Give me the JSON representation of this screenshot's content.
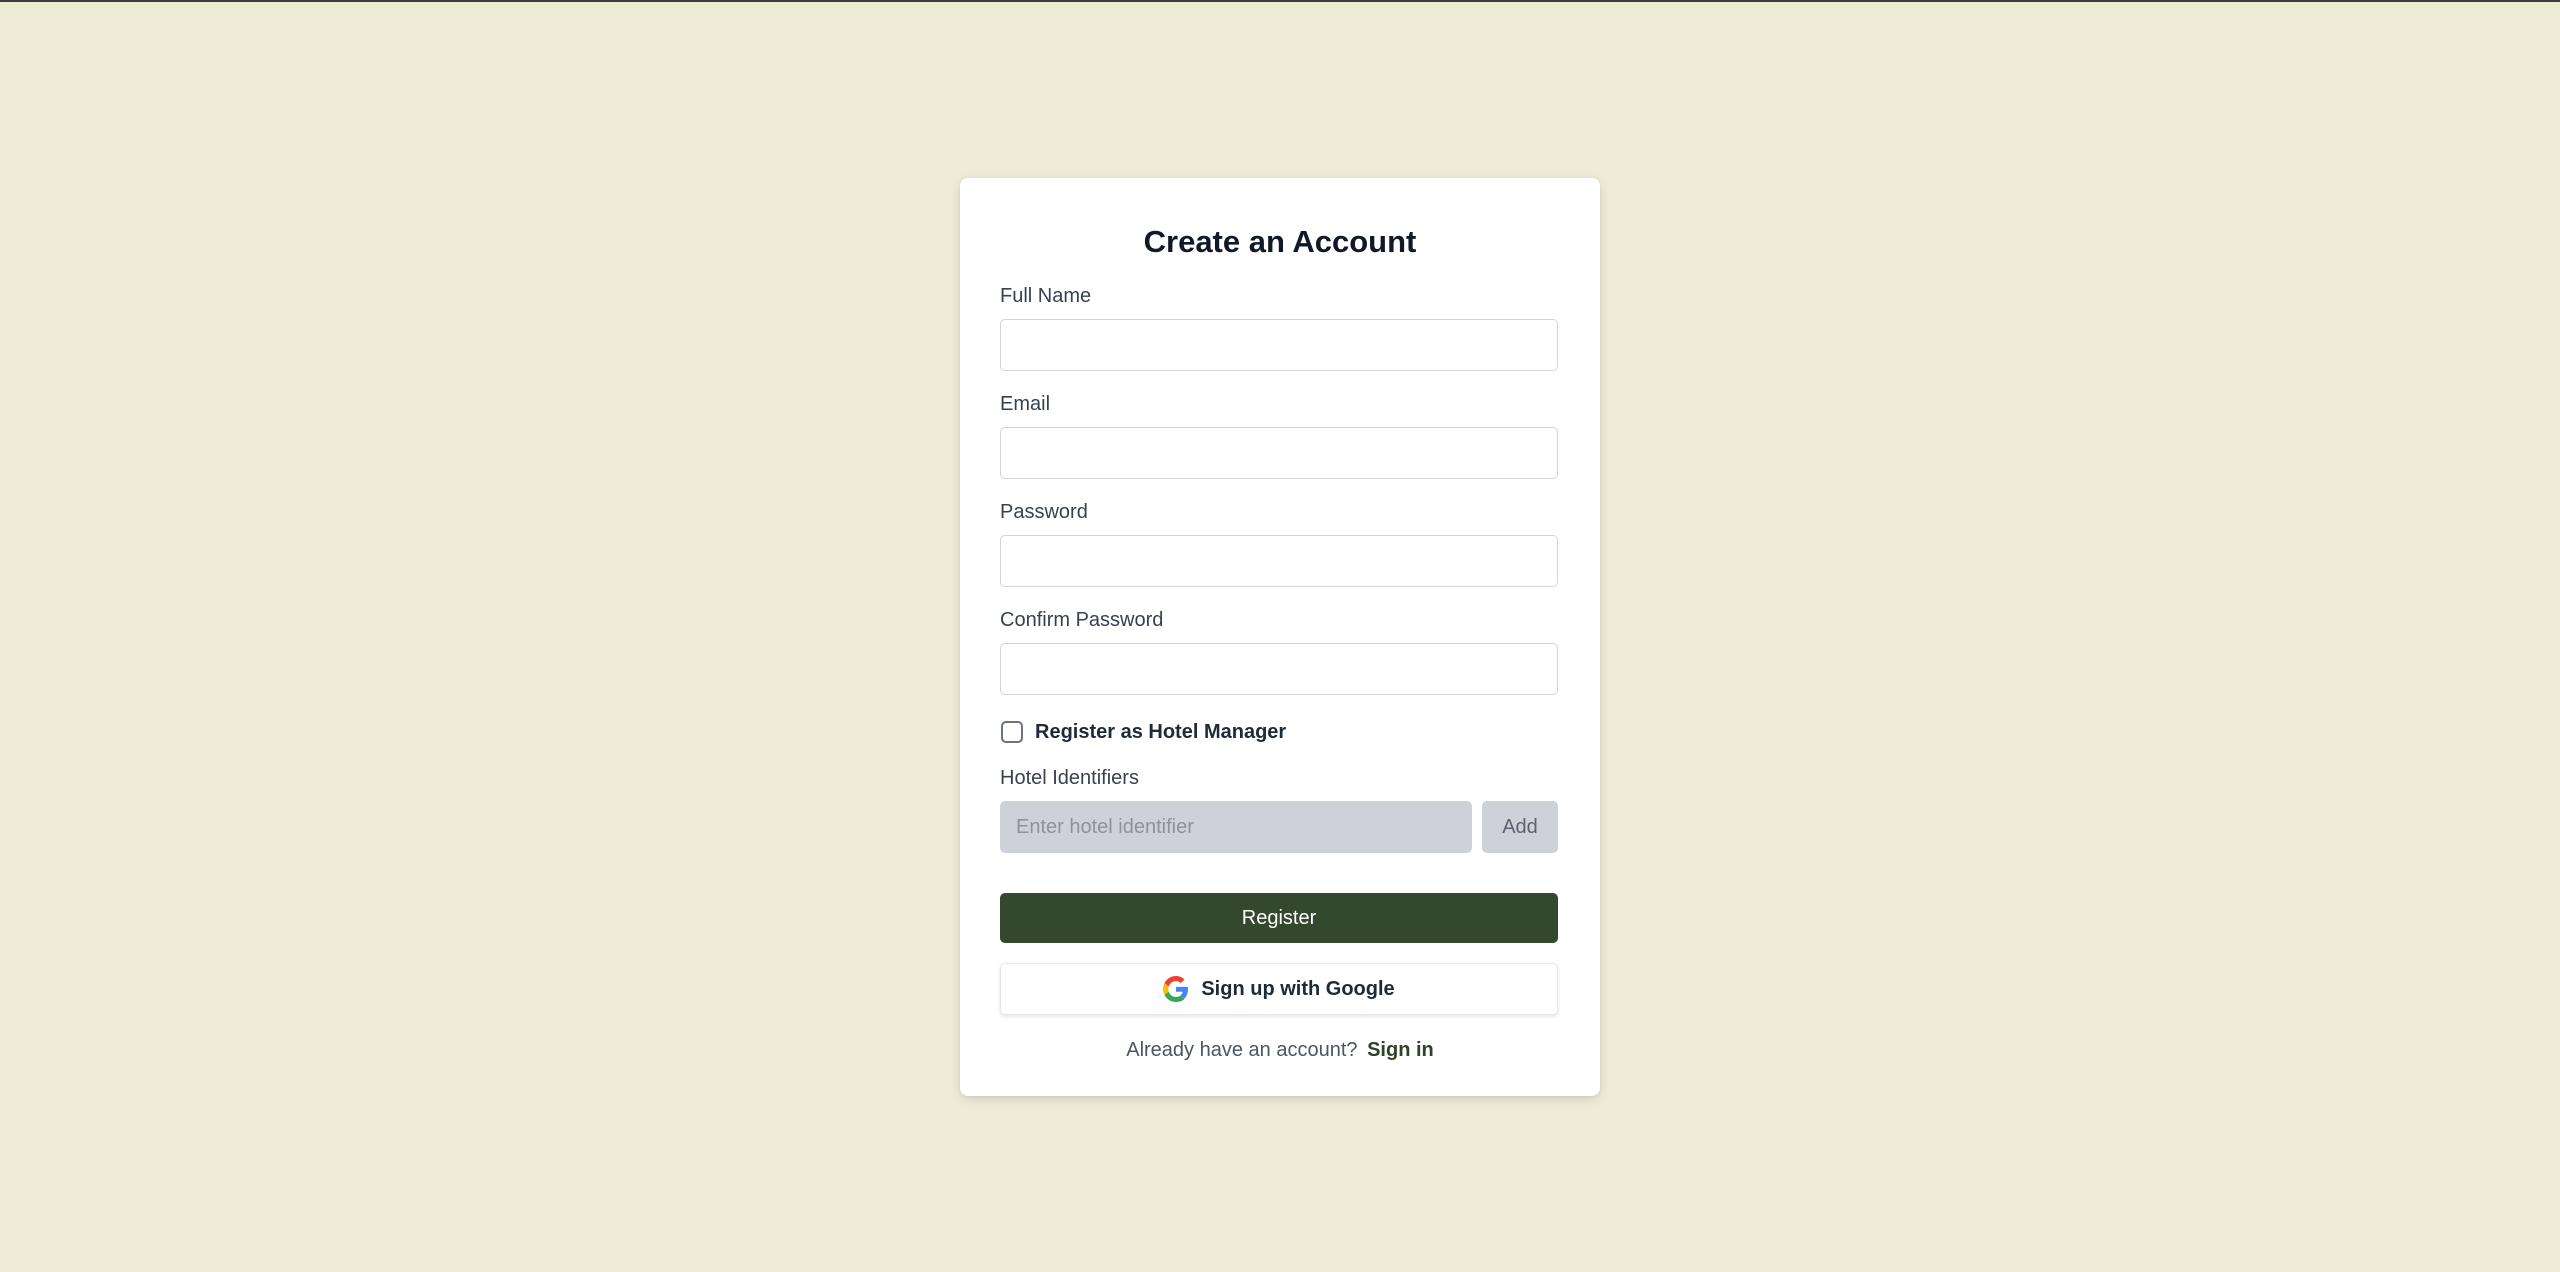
{
  "form": {
    "title": "Create an Account",
    "fields": {
      "full_name": {
        "label": "Full Name",
        "value": "",
        "placeholder": ""
      },
      "email": {
        "label": "Email",
        "value": "",
        "placeholder": ""
      },
      "password": {
        "label": "Password",
        "value": "",
        "placeholder": ""
      },
      "confirm_password": {
        "label": "Confirm Password",
        "value": "",
        "placeholder": ""
      }
    },
    "hotel_manager_checkbox": {
      "label": "Register as Hotel Manager",
      "checked": false
    },
    "hotel_identifiers": {
      "label": "Hotel Identifiers",
      "placeholder": "Enter hotel identifier",
      "add_label": "Add"
    },
    "register_label": "Register",
    "google_label": "Sign up with Google",
    "footer": {
      "text": "Already have an account?",
      "link": "Sign in"
    }
  },
  "colors": {
    "page_background": "#edead5",
    "primary_button": "#34482d",
    "disabled_fill": "#cfd1d8"
  },
  "icons": {
    "google": "google-g-icon"
  }
}
